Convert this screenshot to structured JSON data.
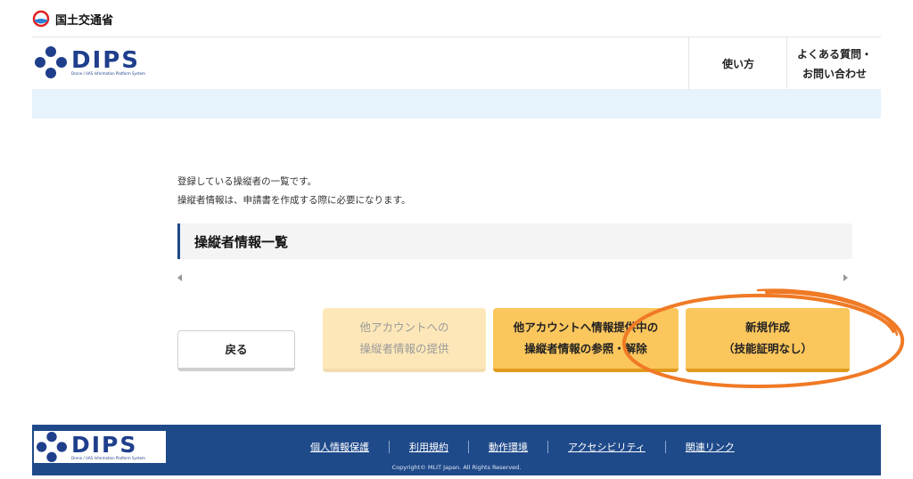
{
  "ministry": {
    "name": "国土交通省",
    "logo_icon": "mlit-logo-icon"
  },
  "header": {
    "logo_text": "DIPS",
    "logo_sub": "Drone / UAS Information Platform System",
    "nav": {
      "howto": "使い方",
      "faq_line1": "よくある質問・",
      "faq_line2": "お問い合わせ"
    }
  },
  "main": {
    "desc_line1": "登録している操縦者の一覧です。",
    "desc_line2": "操縦者情報は、申請書を作成する際に必要になります。",
    "section_title": "操縦者情報一覧"
  },
  "buttons": {
    "back": "戻る",
    "provide_line1": "他アカウントへの",
    "provide_line2": "操縦者情報の提供",
    "ref_line1": "他アカウントへ情報提供中の",
    "ref_line2": "操縦者情報の参照・解除",
    "new_line1": "新規作成",
    "new_line2": "（技能証明なし）"
  },
  "footer": {
    "logo_text": "DIPS",
    "logo_sub": "Drone / UAS Information Platform System",
    "links": [
      "個人情報保護",
      "利用規約",
      "動作環境",
      "アクセシビリティ",
      "関連リンク"
    ],
    "copyright": "Copyright© MLIT Japan. All Rights Reserved."
  },
  "colors": {
    "brand_blue": "#1f4a8a",
    "button_orange": "#fbc65c",
    "button_disabled": "#fde7b8",
    "annotation": "#f07a25"
  }
}
